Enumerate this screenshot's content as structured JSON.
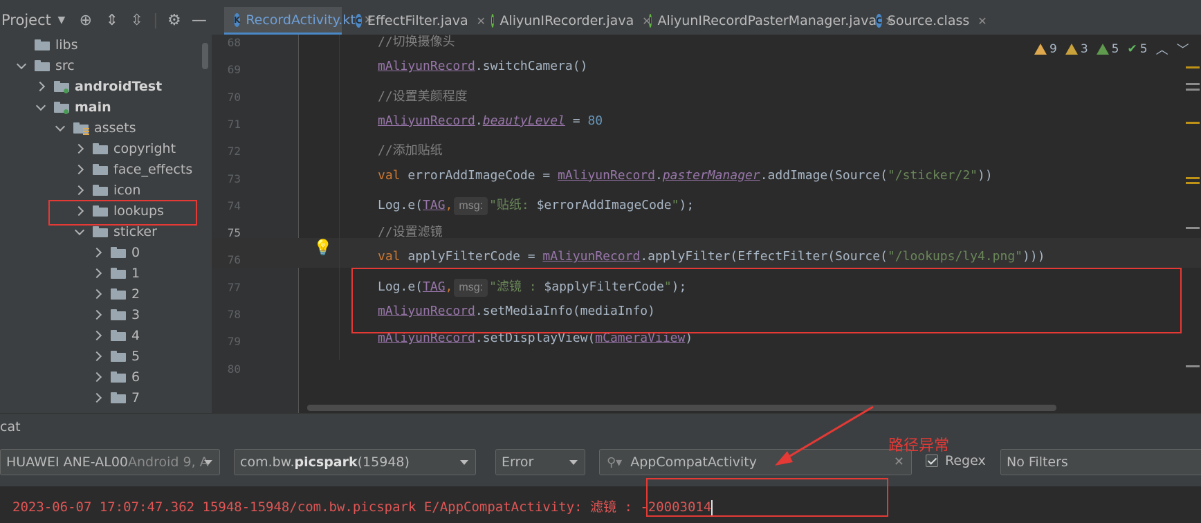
{
  "sidebar": {
    "title": "Project",
    "tree": [
      {
        "label": "libs",
        "chevron": "none",
        "indent": 0
      },
      {
        "label": "src",
        "chevron": "down",
        "indent": 0
      },
      {
        "label": "androidTest",
        "chevron": "right",
        "indent": 1,
        "bold": true
      },
      {
        "label": "main",
        "chevron": "down",
        "indent": 1,
        "bold": true
      },
      {
        "label": "assets",
        "chevron": "down",
        "indent": 2
      },
      {
        "label": "copyright",
        "chevron": "right",
        "indent": 3
      },
      {
        "label": "face_effects",
        "chevron": "right",
        "indent": 3
      },
      {
        "label": "icon",
        "chevron": "right",
        "indent": 3
      },
      {
        "label": "lookups",
        "chevron": "right",
        "indent": 3
      },
      {
        "label": "sticker",
        "chevron": "down",
        "indent": 3
      },
      {
        "label": "0",
        "chevron": "right",
        "indent": 4
      },
      {
        "label": "1",
        "chevron": "right",
        "indent": 4
      },
      {
        "label": "2",
        "chevron": "right",
        "indent": 4
      },
      {
        "label": "3",
        "chevron": "right",
        "indent": 4
      },
      {
        "label": "4",
        "chevron": "right",
        "indent": 4
      },
      {
        "label": "5",
        "chevron": "right",
        "indent": 4
      },
      {
        "label": "6",
        "chevron": "right",
        "indent": 4
      },
      {
        "label": "7",
        "chevron": "right",
        "indent": 4
      }
    ]
  },
  "tabs": [
    {
      "label": "RecordActivity.kt",
      "icon": "kotlin-file-icon",
      "icon_color": "#4a88c7",
      "active": true
    },
    {
      "label": "EffectFilter.java",
      "icon": "class-icon",
      "icon_color": "#4a88c7",
      "active": false
    },
    {
      "label": "AliyunIRecorder.java",
      "icon": "interface-icon",
      "icon_color": "#62b543",
      "active": false
    },
    {
      "label": "AliyunIRecordPasterManager.java",
      "icon": "interface-icon",
      "icon_color": "#62b543",
      "active": false
    },
    {
      "label": "Source.class",
      "icon": "class-icon",
      "icon_color": "#4a88c7",
      "active": false
    }
  ],
  "inspections": {
    "errors": "9",
    "warnings": "3",
    "weak_warnings": "5",
    "typos": "5"
  },
  "editor": {
    "line_numbers": [
      "68",
      "69",
      "70",
      "71",
      "72",
      "73",
      "74",
      "75",
      "76",
      "77",
      "78",
      "79",
      "80"
    ],
    "current_line": "75",
    "lines": {
      "l68": {
        "comment": "//切换摄像头"
      },
      "l69": {
        "obj": "mAliyunRecord",
        "rest": ".switchCamera()"
      },
      "l70": {
        "comment": "//设置美颜程度"
      },
      "l71": {
        "obj": "mAliyunRecord",
        "dot": ".",
        "prop": "beautyLevel",
        "eq": " = ",
        "num": "80"
      },
      "l72": {
        "comment": "//添加贴纸"
      },
      "l73": {
        "kw": "val",
        "name": " errorAddImageCode = ",
        "obj": "mAliyunRecord",
        "dot": ".",
        "prop": "pasterManager",
        "call": ".addImage(Source(",
        "str": "\"/sticker/2\"",
        "end": "))"
      },
      "l74": {
        "call": "Log.e(",
        "tag": "TAG",
        "comma": ",",
        "hint": "msg:",
        "str1": "\"贴纸: ",
        "var": "$errorAddImageCode",
        "str2": "\"",
        "end": ");"
      },
      "l75": {
        "comment": "//设置滤镜"
      },
      "l76": {
        "kw": "val",
        "name": " applyFilterCode = ",
        "obj": "mAliyunRecord",
        "call": ".applyFilter(EffectFilter(Source(",
        "str": "\"/lookups/ly4.png\"",
        "end": ")))"
      },
      "l77": {
        "call": "Log.e(",
        "tag": "TAG",
        "comma": ",",
        "hint": "msg:",
        "str1": "\"滤镜 : ",
        "var": "$applyFilterCode",
        "str2": "\"",
        "end": ");"
      },
      "l78": {
        "obj": "mAliyunRecord",
        "rest": ".setMediaInfo(mediaInfo)"
      },
      "l79": {
        "obj": "mAliyunRecord",
        "call": ".setDisplayView(",
        "arg": "mCameraViiew",
        "end": ")"
      }
    }
  },
  "logcat": {
    "title": "cat",
    "device": {
      "name": "HUAWEI ANE-AL00",
      "detail": " Android 9, A"
    },
    "process": {
      "prefix": "com.bw.",
      "bold": "picspark",
      "pid": " (15948)"
    },
    "level": "Error",
    "search_value": "AppCompatActivity",
    "regex_label": "Regex",
    "filter": "No Filters",
    "log_line": "2023-06-07 17:07:47.362 15948-15948/com.bw.picspark E/AppCompatActivity: 滤镜 : -20003014"
  },
  "annotation": {
    "label": "路径异常",
    "color": "#e53935"
  }
}
